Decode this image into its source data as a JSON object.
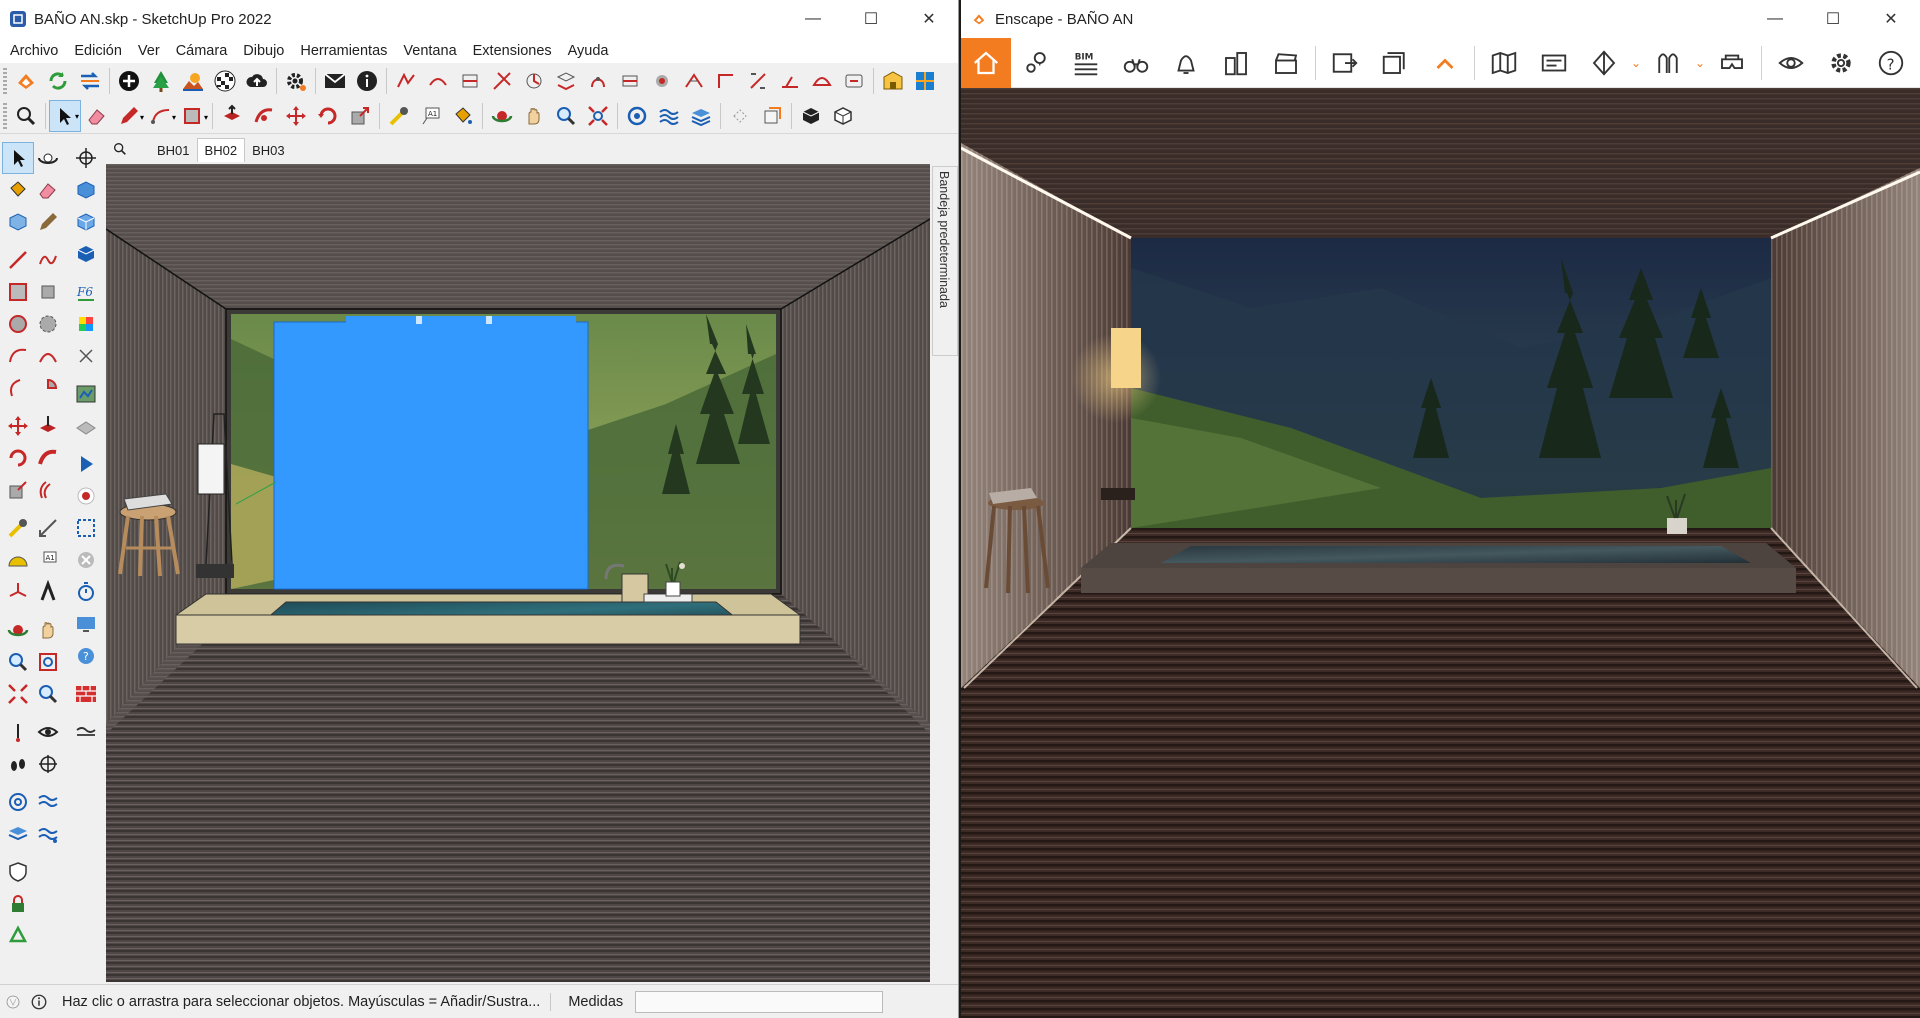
{
  "sketchup": {
    "title": "BAÑO AN.skp - SketchUp Pro 2022",
    "menu": [
      "Archivo",
      "Edición",
      "Ver",
      "Cámara",
      "Dibujo",
      "Herramientas",
      "Ventana",
      "Extensiones",
      "Ayuda"
    ],
    "scene_tabs": [
      "BH01",
      "BH02",
      "BH03"
    ],
    "active_tab": "BH02",
    "tray_label": "Bandeja predeterminada",
    "status_text": "Haz clic o arrastra para seleccionar objetos. Mayúsculas = Añadir/Sustra...",
    "measure_label": "Medidas",
    "measure_value": "",
    "accent_selection": "#3399ff"
  },
  "enscape": {
    "title": "Enscape - BAÑO AN",
    "accent": "#f47c20",
    "bim_label": "BIM",
    "toolbar_icons": [
      "home-icon",
      "location-icon",
      "bim-icon",
      "binoculars-icon",
      "bell-icon",
      "buildings-icon",
      "clapperboard-icon",
      "export-image-icon",
      "batch-export-icon",
      "collapse-icon",
      "map-icon",
      "panorama-icon",
      "section-icon",
      "asset-library-icon",
      "vr-headset-icon",
      "visibility-icon",
      "settings-icon",
      "help-icon"
    ]
  },
  "window_controls": {
    "minimize": "—",
    "maximize": "☐",
    "close": "✕"
  }
}
